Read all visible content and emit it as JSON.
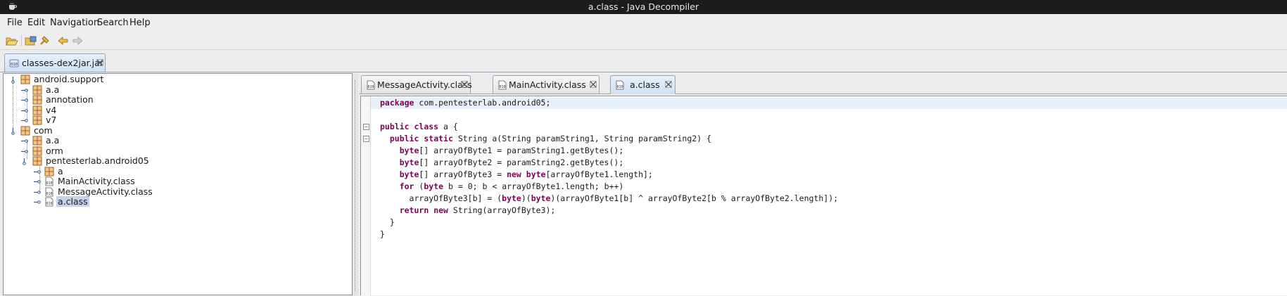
{
  "window": {
    "title": "a.class - Java Decompiler",
    "app_icon": "coffee-cup-icon"
  },
  "menu": [
    {
      "label": "File"
    },
    {
      "label": "Edit"
    },
    {
      "label": "Navigation"
    },
    {
      "label": "Search"
    },
    {
      "label": "Help"
    }
  ],
  "toolbar": {
    "buttons": [
      {
        "icon": "open-file-icon"
      },
      {
        "icon": "open-type-icon"
      },
      {
        "icon": "search-icon"
      },
      {
        "icon": "back-arrow-icon"
      },
      {
        "icon": "forward-arrow-icon"
      }
    ]
  },
  "jar_tab": {
    "label": "classes-dex2jar.jar",
    "icon": "jar-file-icon"
  },
  "tree": [
    {
      "label": "android.support",
      "type": "package",
      "depth": 0
    },
    {
      "label": "a.a",
      "type": "package",
      "depth": 1
    },
    {
      "label": "annotation",
      "type": "package",
      "depth": 1
    },
    {
      "label": "v4",
      "type": "package",
      "depth": 1
    },
    {
      "label": "v7",
      "type": "package",
      "depth": 1
    },
    {
      "label": "com",
      "type": "package",
      "depth": 0
    },
    {
      "label": "a.a",
      "type": "package",
      "depth": 1
    },
    {
      "label": "orm",
      "type": "package",
      "depth": 1
    },
    {
      "label": "pentesterlab.android05",
      "type": "package",
      "depth": 1
    },
    {
      "label": "a",
      "type": "package",
      "depth": 2
    },
    {
      "label": "MainActivity.class",
      "type": "class",
      "depth": 2
    },
    {
      "label": "MessageActivity.class",
      "type": "class",
      "depth": 2
    },
    {
      "label": "a.class",
      "type": "class",
      "depth": 2,
      "selected": true
    }
  ],
  "editor_tabs": [
    {
      "label": "MessageActivity.class",
      "active": false
    },
    {
      "label": "MainActivity.class",
      "active": false
    },
    {
      "label": "a.class",
      "active": true
    }
  ],
  "code": [
    "package com.pentesterlab.android05;",
    "",
    "public class a {",
    "  public static String a(String paramString1, String paramString2) {",
    "    byte[] arrayOfByte1 = paramString1.getBytes();",
    "    byte[] arrayOfByte2 = paramString2.getBytes();",
    "    byte[] arrayOfByte3 = new byte[arrayOfByte1.length];",
    "    for (byte b = 0; b < arrayOfByte1.length; b++)",
    "      arrayOfByte3[b] = (byte)(byte)(arrayOfByte1[b] ^ arrayOfByte2[b % arrayOfByte2.length]);",
    "    return new String(arrayOfByte3);",
    "  }",
    "}"
  ],
  "colors": {
    "keyword": "#7f0055",
    "selection": "#c3d4ea",
    "line_highlight": "#e8f0fa",
    "titlebar": "#1c1c1c"
  }
}
